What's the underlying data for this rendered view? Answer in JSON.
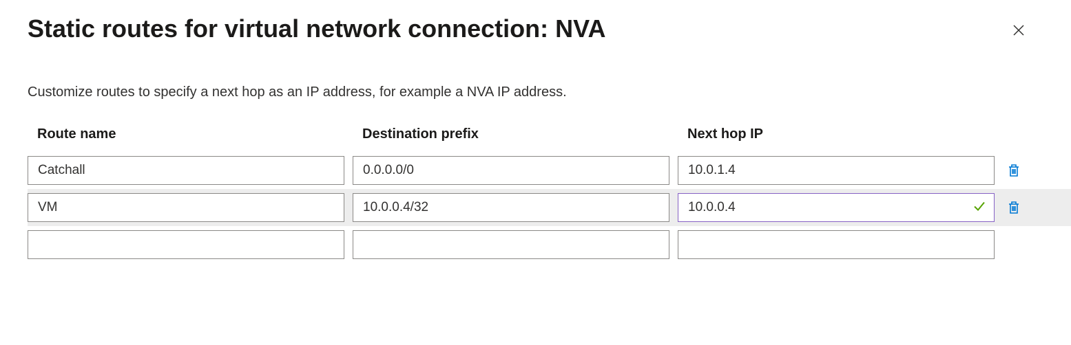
{
  "header": {
    "title": "Static routes for virtual network connection: NVA"
  },
  "description": "Customize routes to specify a next hop as an IP address, for example a NVA IP address.",
  "columns": {
    "route_name": "Route name",
    "destination_prefix": "Destination prefix",
    "next_hop_ip": "Next hop IP"
  },
  "rows": [
    {
      "route_name": "Catchall",
      "destination_prefix": "0.0.0.0/0",
      "next_hop_ip": "10.0.1.4",
      "highlight": false,
      "validated": false,
      "deletable": true
    },
    {
      "route_name": "VM",
      "destination_prefix": "10.0.0.4/32",
      "next_hop_ip": "10.0.0.4",
      "highlight": true,
      "validated": true,
      "deletable": true
    },
    {
      "route_name": "",
      "destination_prefix": "",
      "next_hop_ip": "",
      "highlight": false,
      "validated": false,
      "deletable": false
    }
  ],
  "colors": {
    "accent": "#0078d4",
    "focus": "#8661c5",
    "success": "#57a300"
  }
}
